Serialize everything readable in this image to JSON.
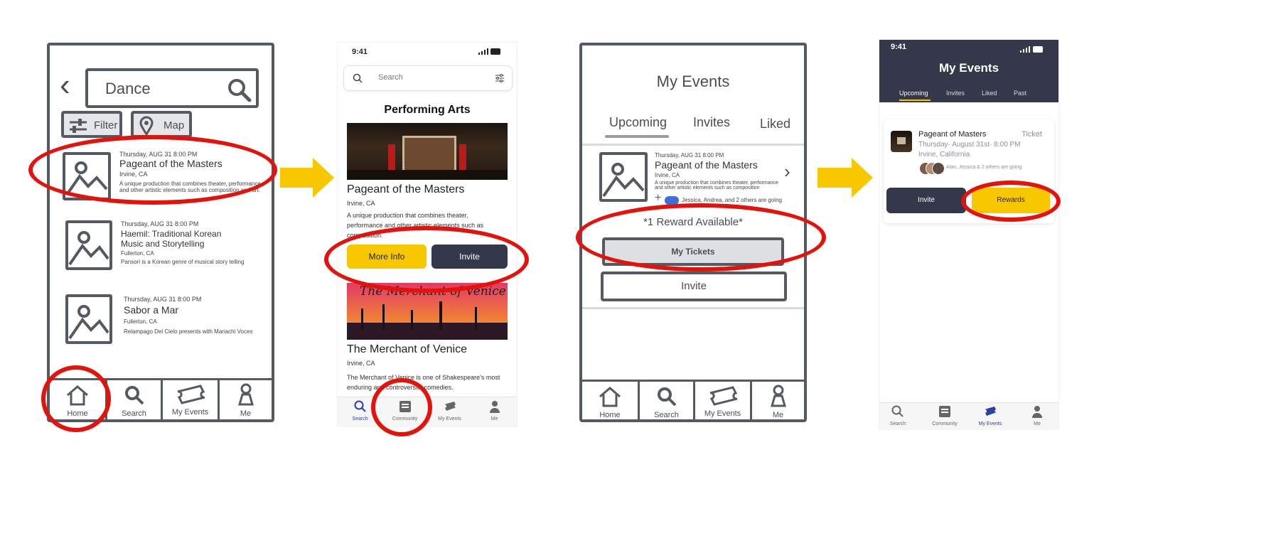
{
  "arrow_color": "#f7c800",
  "highlight_color": "#e3120b",
  "brand_navy": "#34384a",
  "brand_yellow": "#f7c800",
  "sketch1": {
    "search_text": "Dance",
    "filter_label": "Filter",
    "map_label": "Map",
    "events": [
      {
        "date": "Thursday, AUG 31  8:00 PM",
        "title": "Pageant of the Masters",
        "location": "Irvine, CA",
        "desc": "A unique production that combines theater, performance and other artistic elements such as composition and art."
      },
      {
        "date": "Thursday, AUG 31  8:00 PM",
        "title": "Haemil: Traditional Korean Music and Storytelling",
        "location": "Fullerton, CA",
        "desc": "Pansori is a Korean genre of musical story telling"
      },
      {
        "date": "Thursday, AUG 31  8:00 PM",
        "title": "Sabor a Mar",
        "location": "Fullerton, CA",
        "desc": "Relampago Del Cielo presents with Mariachi Voces"
      }
    ],
    "nav": [
      "Home",
      "Search",
      "My Events",
      "Me"
    ]
  },
  "phone1": {
    "time": "9:41",
    "search_placeholder": "Search",
    "section_title": "Performing Arts",
    "card1": {
      "title": "Pageant of the Masters",
      "location": "Irvine, CA",
      "desc": "A unique production that combines theater, performance and other artistic elements such as composition.",
      "more_info": "More Info",
      "invite": "Invite"
    },
    "card2": {
      "banner": "The Merchant of Venice",
      "title": "The Merchant of Venice",
      "location": "Irvine, CA",
      "desc": "The Merchant of Venice is one of Shakespeare's most enduring and controversial comedies."
    },
    "nav": [
      "Search",
      "Community",
      "My Events",
      "Me"
    ]
  },
  "sketch2": {
    "title": "My Events",
    "tabs": [
      "Upcoming",
      "Invites",
      "Liked"
    ],
    "event": {
      "date": "Thursday, AUG 31  8:00 PM",
      "title": "Pageant of the Masters",
      "location": "Irvine, CA",
      "desc": "A unique production that combines theater, performance and other artistic elements such as composition",
      "going": "Jessica, Andrea, and 2 others are going"
    },
    "reward": "*1 Reward Available*",
    "my_tickets": "My Tickets",
    "invite": "Invite",
    "nav": [
      "Home",
      "Search",
      "My Events",
      "Me"
    ]
  },
  "phone2": {
    "time": "9:41",
    "title": "My Events",
    "tabs": [
      "Upcoming",
      "Invites",
      "Liked",
      "Past"
    ],
    "event": {
      "title": "Pageant of Masters",
      "ticket": "Ticket",
      "datetime": "Thursday· August 31st· 8:00 PM",
      "location": "Irvine, California",
      "going": "Alan, Jessica & 2 others are going"
    },
    "invite": "Invite",
    "rewards": "Rewards",
    "nav": [
      "Search",
      "Community",
      "My Events",
      "Me"
    ]
  }
}
